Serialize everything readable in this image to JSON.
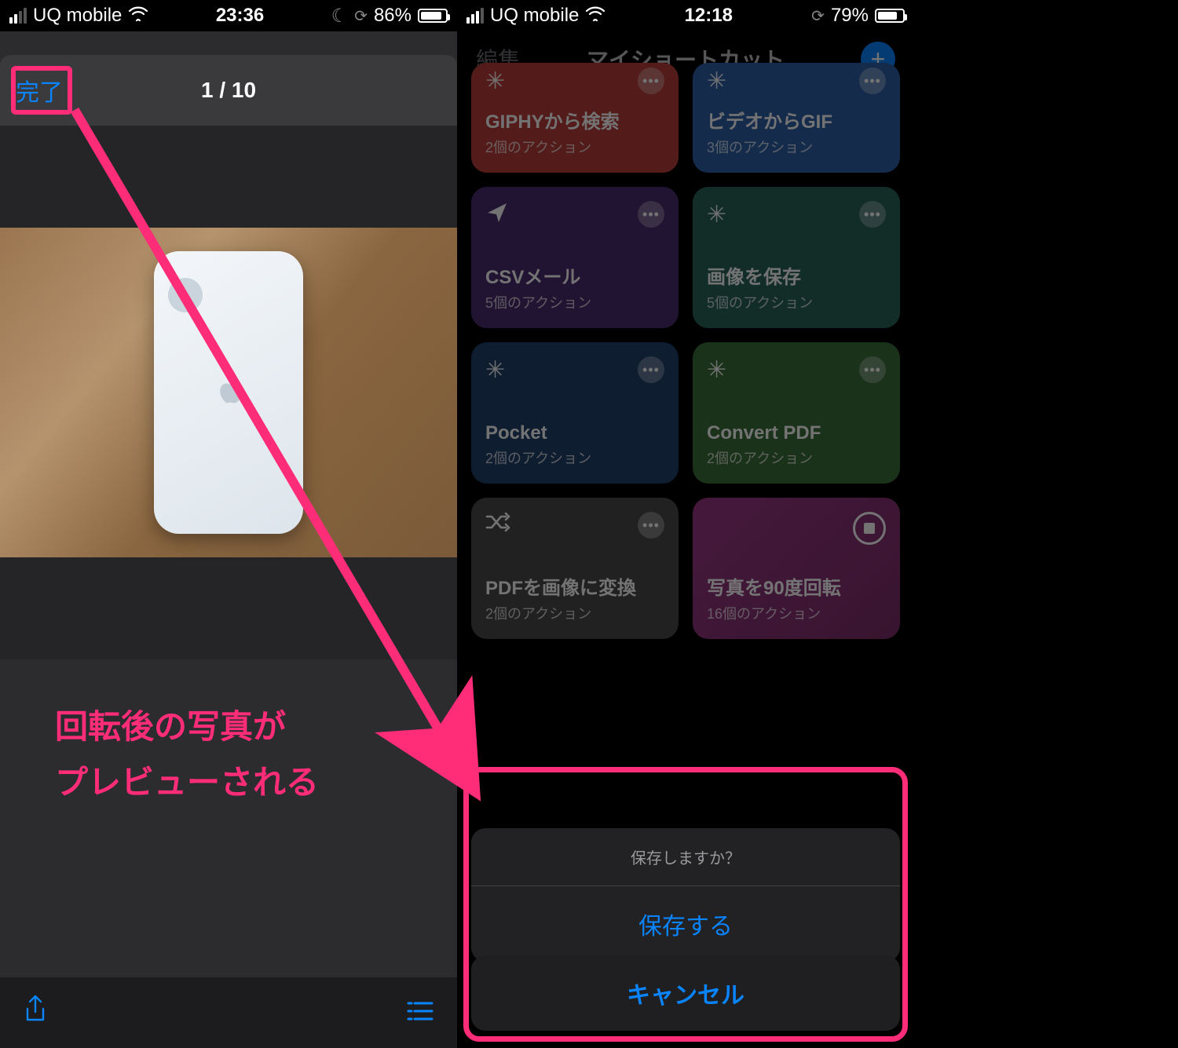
{
  "left": {
    "status": {
      "carrier": "UQ mobile",
      "time": "23:36",
      "battery_pct": "86%"
    },
    "done_label": "完了",
    "counter": "1 / 10",
    "caption_line1": "回転後の写真が",
    "caption_line2": "プレビューされる"
  },
  "right": {
    "status": {
      "carrier": "UQ mobile",
      "time": "12:18",
      "battery_pct": "79%"
    },
    "header": {
      "edit": "編集",
      "title": "マイショートカット",
      "add": "+"
    },
    "cards": [
      {
        "title": "GIPHYから検索",
        "sub": "2個のアクション"
      },
      {
        "title": "ビデオからGIF",
        "sub": "3個のアクション"
      },
      {
        "title": "CSVメール",
        "sub": "5個のアクション"
      },
      {
        "title": "画像を保存",
        "sub": "5個のアクション"
      },
      {
        "title": "Pocket",
        "sub": "2個のアクション"
      },
      {
        "title": "Convert PDF",
        "sub": "2個のアクション"
      },
      {
        "title": "PDFを画像に変換",
        "sub": "2個のアクション"
      },
      {
        "title": "写真を90度回転",
        "sub": "16個のアクション"
      }
    ],
    "sheet": {
      "title": "保存しますか？",
      "save": "保存する",
      "cancel": "キャンセル"
    }
  }
}
